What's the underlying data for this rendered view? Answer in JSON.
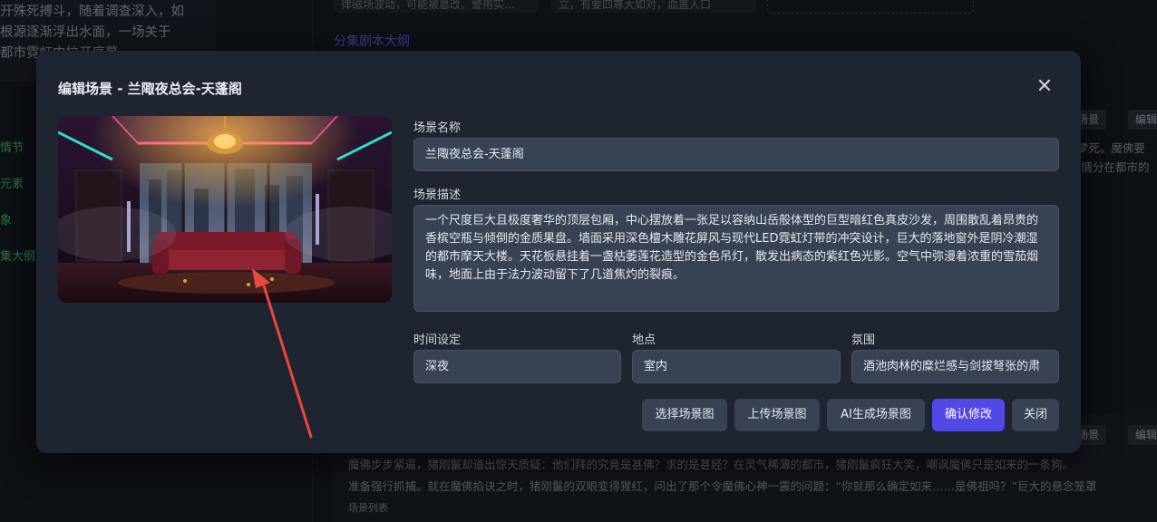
{
  "background": {
    "left_text_lines": [
      "开殊死搏斗，随着调查深入，如",
      "根源逐渐浮出水面，一场关于",
      "都市霓虹中拉开序幕"
    ],
    "nav_items": [
      "情节",
      "元素",
      "象",
      "集大纲"
    ],
    "top_chips": [
      "律磁场波动，可能被篡改。警用实...",
      "立，有要四尊大如对，血盖人口"
    ],
    "episode_outline_link": "分集剧本大纲",
    "right_buttons": [
      "成场景",
      "编辑"
    ],
    "right_snippets": [
      "E梦死。魔佛要",
      "的情分在都市的"
    ],
    "bottom_lines": [
      "魔佛步步紧逼，猪刚鬣却道出惊天质疑：他们拜的究竟是甚佛？求的是甚经？在灵气稀薄的都市，猪刚鬣疯狂大笑，嘲讽魔佛只是如来的一条狗。",
      "准备强行抓捕。就在魔佛掐诀之时，猪刚鬣的双眼变得猩红，问出了那个令魔佛心神一震的问题：“你就那么确定如来……是佛祖吗？”巨大的悬念笼罩"
    ],
    "scene_list_label": "场景列表"
  },
  "modal": {
    "title": "编辑场景 - 兰陬夜总会-天蓬阁",
    "name_label": "场景名称",
    "name_value": "兰陬夜总会-天蓬阁",
    "desc_label": "场景描述",
    "desc_value": "一个尺度巨大且极度奢华的顶层包厢，中心摆放着一张足以容纳山岳般体型的巨型暗红色真皮沙发，周围散乱着昂贵的香槟空瓶与倾倒的金质果盘。墙面采用深色檀木雕花屏风与现代LED霓虹灯带的冲突设计，巨大的落地窗外是阴冷潮湿的都市摩天大楼。天花板悬挂着一盏枯萎莲花造型的金色吊灯，散发出病态的紫红色光影。空气中弥漫着浓重的雪茄烟味，地面上由于法力波动留下了几道焦灼的裂痕。",
    "time_label": "时间设定",
    "time_value": "深夜",
    "place_label": "地点",
    "place_value": "室内",
    "mood_label": "氛围",
    "mood_value": "酒池肉林的糜烂感与剑拔弩张的肃",
    "buttons": {
      "select_image": "选择场景图",
      "upload_image": "上传场景图",
      "ai_generate": "AI生成场景图",
      "confirm": "确认修改",
      "close": "关闭"
    }
  },
  "colors": {
    "primary_button": "#5248e6",
    "annotation_arrow": "#e8483f",
    "neon_cyan": "#27e0c8",
    "neon_pink": "#ff3fa8"
  }
}
